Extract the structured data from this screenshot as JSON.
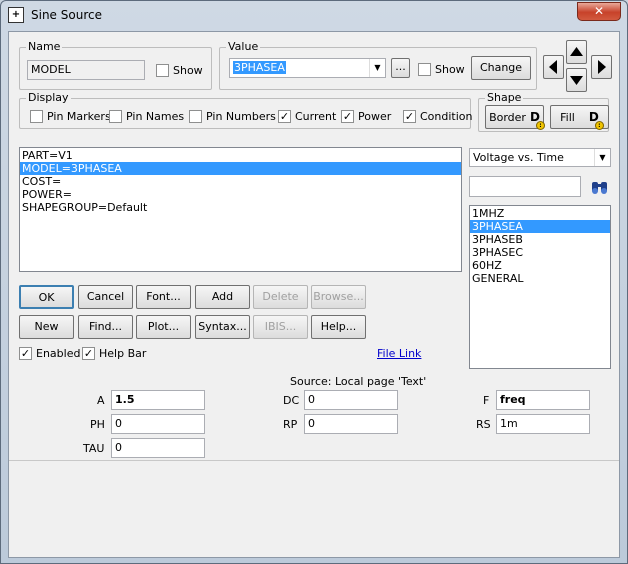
{
  "window": {
    "title": "Sine Source",
    "close_label": "✕"
  },
  "name_group": {
    "label": "Name",
    "value": "MODEL",
    "show_label": "Show",
    "show_checked": false
  },
  "value_group": {
    "label": "Value",
    "value": "3PHASEA",
    "ellipsis_label": "...",
    "show_label": "Show",
    "show_checked": false,
    "change_label": "Change"
  },
  "display_group": {
    "label": "Display",
    "options": [
      {
        "label": "Pin Markers",
        "checked": false
      },
      {
        "label": "Pin Names",
        "checked": false
      },
      {
        "label": "Pin Numbers",
        "checked": false
      },
      {
        "label": "Current",
        "checked": true
      },
      {
        "label": "Power",
        "checked": true
      },
      {
        "label": "Condition",
        "checked": true
      }
    ]
  },
  "shape_group": {
    "label": "Shape",
    "border_label": "Border",
    "fill_label": "Fill",
    "icon_text": "D"
  },
  "attributes": [
    "PART=V1",
    "MODEL=3PHASEA",
    "COST=",
    "POWER=",
    "SHAPEGROUP=Default"
  ],
  "attributes_selected": 1,
  "plot_select": {
    "value": "Voltage vs. Time"
  },
  "search": {
    "value": ""
  },
  "models": [
    "1MHZ",
    "3PHASEA",
    "3PHASEB",
    "3PHASEC",
    "60HZ",
    "GENERAL"
  ],
  "models_selected": 1,
  "buttons_row1": [
    {
      "label": "OK",
      "enabled": true
    },
    {
      "label": "Cancel",
      "enabled": true
    },
    {
      "label": "Font...",
      "enabled": true
    },
    {
      "label": "Add",
      "enabled": true
    },
    {
      "label": "Delete",
      "enabled": false
    },
    {
      "label": "Browse...",
      "enabled": false
    }
  ],
  "buttons_row2": [
    {
      "label": "New",
      "enabled": true
    },
    {
      "label": "Find...",
      "enabled": true
    },
    {
      "label": "Plot...",
      "enabled": true
    },
    {
      "label": "Syntax...",
      "enabled": true
    },
    {
      "label": "IBIS...",
      "enabled": false
    },
    {
      "label": "Help...",
      "enabled": true
    }
  ],
  "enabled_cb": {
    "label": "Enabled",
    "checked": true
  },
  "helpbar_cb": {
    "label": "Help Bar",
    "checked": true
  },
  "file_link": "File Link",
  "source_text": "Source: Local page 'Text'",
  "params": {
    "A": {
      "label": "A",
      "value": "1.5"
    },
    "DC": {
      "label": "DC",
      "value": "0"
    },
    "F": {
      "label": "F",
      "value": "freq"
    },
    "PH": {
      "label": "PH",
      "value": "0"
    },
    "RP": {
      "label": "RP",
      "value": "0"
    },
    "RS": {
      "label": "RS",
      "value": "1m"
    },
    "TAU": {
      "label": "TAU",
      "value": "0"
    }
  }
}
